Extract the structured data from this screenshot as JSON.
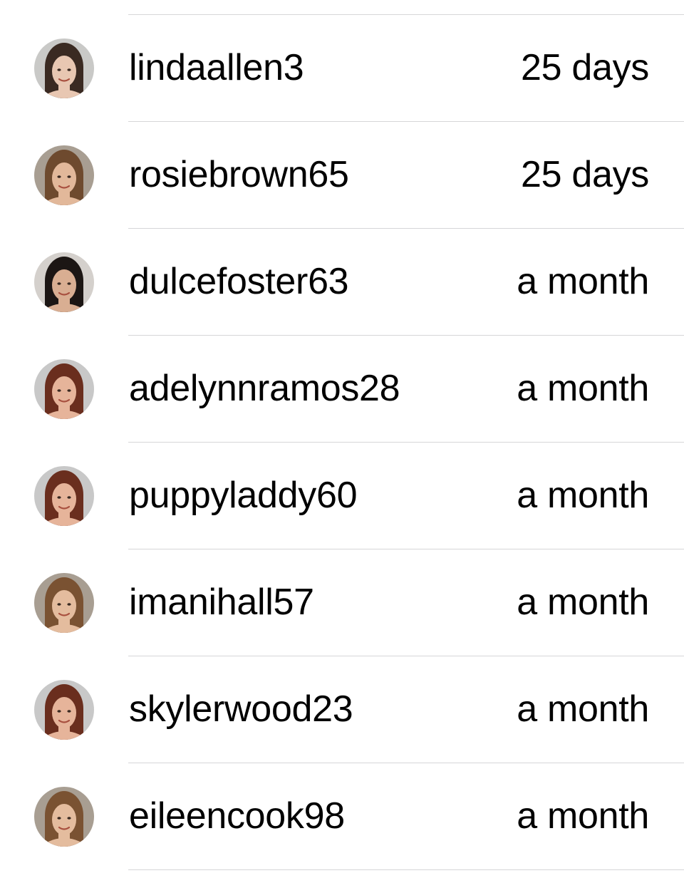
{
  "followers": [
    {
      "username": "lindaallen3",
      "time": "25 days",
      "avatar": {
        "bg": "#c9c9c7",
        "hair": "#3a2a22",
        "skin": "#e8c7b2"
      }
    },
    {
      "username": "rosiebrown65",
      "time": "25 days",
      "avatar": {
        "bg": "#a89e92",
        "hair": "#6e4a2e",
        "skin": "#e2b89a"
      }
    },
    {
      "username": "dulcefoster63",
      "time": "a month",
      "avatar": {
        "bg": "#d4d0cc",
        "hair": "#1c1614",
        "skin": "#d9ae92"
      }
    },
    {
      "username": "adelynnramos28",
      "time": "a month",
      "avatar": {
        "bg": "#c8c8c8",
        "hair": "#6a2e1e",
        "skin": "#e6b49a"
      }
    },
    {
      "username": "puppyladdy60",
      "time": "a month",
      "avatar": {
        "bg": "#c8c8c8",
        "hair": "#6a2e1e",
        "skin": "#e6b49a"
      }
    },
    {
      "username": "imanihall57",
      "time": "a month",
      "avatar": {
        "bg": "#a89e92",
        "hair": "#7a5232",
        "skin": "#e4bc9e"
      }
    },
    {
      "username": "skylerwood23",
      "time": "a month",
      "avatar": {
        "bg": "#c8c8c8",
        "hair": "#6a2e1e",
        "skin": "#e6b49a"
      }
    },
    {
      "username": "eileencook98",
      "time": "a month",
      "avatar": {
        "bg": "#a89e92",
        "hair": "#7a5232",
        "skin": "#e4bc9e"
      }
    }
  ],
  "colors": {
    "divider": "#d6d6d8",
    "text": "#000000",
    "background": "#ffffff"
  },
  "icons": {
    "avatar": "user-avatar-icon"
  }
}
